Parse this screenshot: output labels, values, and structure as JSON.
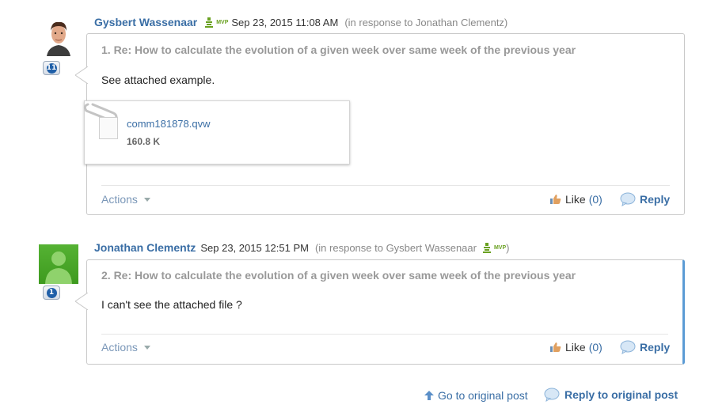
{
  "posts": [
    {
      "author": "Gysbert Wassenaar",
      "mvp_label": "MVP",
      "date": "Sep 23, 2015 11:08 AM",
      "response_to": "(in response to Jonathan Clementz)",
      "rank": "11",
      "subject": "1. Re: How to calculate the evolution of a given week over same week of the previous year",
      "body": "See attached example.",
      "attachment": {
        "name": "comm181878.qvw",
        "size": "160.8 K"
      },
      "actions_label": "Actions",
      "like_label": "Like",
      "like_count": "(0)",
      "reply_label": "Reply"
    },
    {
      "author": "Jonathan Clementz",
      "date": "Sep 23, 2015 12:51 PM",
      "response_prefix": "(in response to Gysbert Wassenaar",
      "response_suffix": ")",
      "mvp_label": "MVP",
      "rank": "1",
      "subject": "2. Re: How to calculate the evolution of a given week over same week of the previous year",
      "body": "I can't see the attached file ?",
      "actions_label": "Actions",
      "like_label": "Like",
      "like_count": "(0)",
      "reply_label": "Reply"
    }
  ],
  "footer": {
    "goto_label": "Go to original post",
    "reply_original_label": "Reply to original post"
  },
  "colors": {
    "link": "#3a6ea5",
    "mvp": "#6aa121",
    "selected_border": "#5b9bd5"
  }
}
